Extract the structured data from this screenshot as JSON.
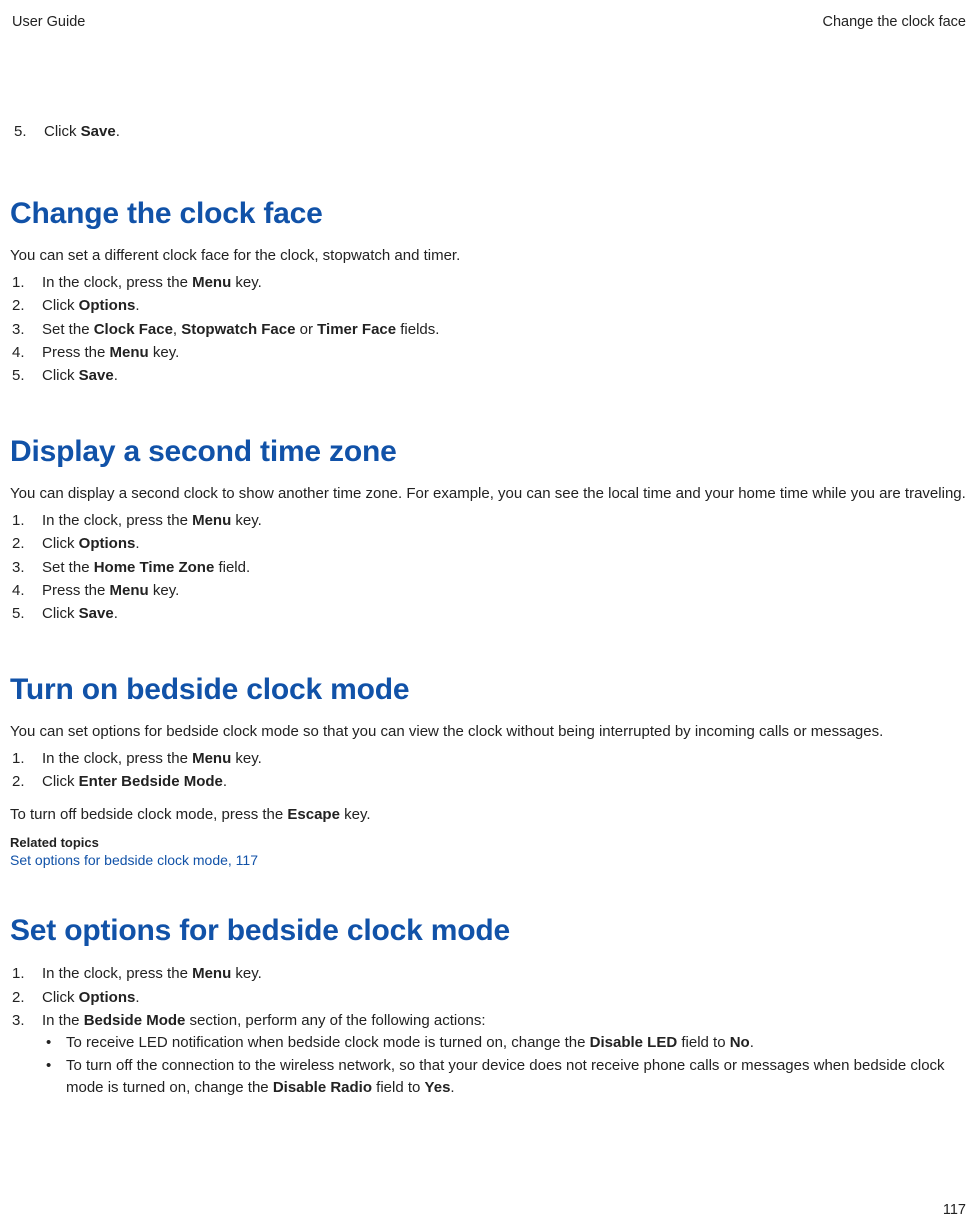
{
  "header": {
    "left": "User Guide",
    "right": "Change the clock face"
  },
  "prelude": {
    "steps": [
      {
        "pre": "Click ",
        "bold": "Save",
        "post": "."
      }
    ]
  },
  "s1": {
    "title": "Change the clock face",
    "intro": "You can set a different clock face for the clock, stopwatch and timer.",
    "steps": [
      {
        "pre": "In the clock, press the ",
        "bold": "Menu",
        "post": " key."
      },
      {
        "pre": "Click ",
        "bold": "Options",
        "post": "."
      },
      {
        "pre": "Set the ",
        "bold": "Clock Face",
        "post1": ", ",
        "bold2": "Stopwatch Face",
        "post2": " or ",
        "bold3": "Timer Face",
        "post3": " fields."
      },
      {
        "pre": "Press the ",
        "bold": "Menu",
        "post": " key."
      },
      {
        "pre": "Click ",
        "bold": "Save",
        "post": "."
      }
    ]
  },
  "s2": {
    "title": "Display a second time zone",
    "intro": "You can display a second clock to show another time zone. For example, you can see the local time and your home time while you are traveling.",
    "steps": [
      {
        "pre": "In the clock, press the ",
        "bold": "Menu",
        "post": " key."
      },
      {
        "pre": "Click ",
        "bold": "Options",
        "post": "."
      },
      {
        "pre": "Set the ",
        "bold": "Home Time Zone",
        "post": " field."
      },
      {
        "pre": "Press the ",
        "bold": "Menu",
        "post": " key."
      },
      {
        "pre": "Click ",
        "bold": "Save",
        "post": "."
      }
    ]
  },
  "s3": {
    "title": "Turn on bedside clock mode",
    "intro": "You can set options for bedside clock mode so that you can view the clock without being interrupted by incoming calls or messages.",
    "steps": [
      {
        "pre": "In the clock, press the ",
        "bold": "Menu",
        "post": " key."
      },
      {
        "pre": "Click ",
        "bold": "Enter Bedside Mode",
        "post": "."
      }
    ],
    "note_pre": "To turn off bedside clock mode, press the ",
    "note_bold": "Escape",
    "note_post": " key.",
    "related_head": "Related topics",
    "related_link": "Set options for bedside clock mode, 117"
  },
  "s4": {
    "title": "Set options for bedside clock mode",
    "steps": [
      {
        "pre": "In the clock, press the ",
        "bold": "Menu",
        "post": " key."
      },
      {
        "pre": "Click ",
        "bold": "Options",
        "post": "."
      },
      {
        "pre": "In the ",
        "bold": "Bedside Mode",
        "post": " section, perform any of the following actions:"
      }
    ],
    "bullets": [
      {
        "pre": "To receive LED notification when bedside clock mode is turned on, change the ",
        "bold": "Disable LED",
        "post1": " field to ",
        "bold2": "No",
        "post2": "."
      },
      {
        "pre": "To turn off the connection to the wireless network, so that your device does not receive phone calls or messages when bedside clock mode is turned on, change the ",
        "bold": "Disable Radio",
        "post1": " field to ",
        "bold2": "Yes",
        "post2": "."
      }
    ]
  },
  "page_number": "117"
}
